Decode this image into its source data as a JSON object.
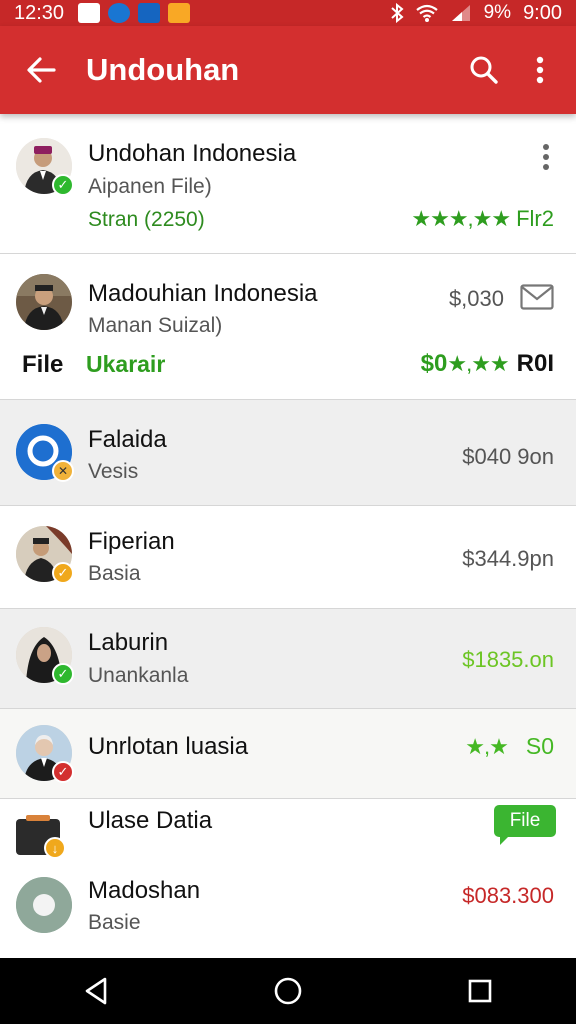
{
  "status_bar": {
    "time": "12:30",
    "battery": "9%",
    "clock": "9:00"
  },
  "app_bar": {
    "title": "Undouhan"
  },
  "items": [
    {
      "name": "Undohan Indonesia",
      "sub": "Aipanen File)",
      "extra": "Stran (2250)",
      "stars": "★★★,★★",
      "rating_text": "Flr2",
      "badge": "check-green"
    },
    {
      "name": "Madouhian Indonesia",
      "sub": "Manan Suizal)",
      "price": "$,030",
      "file_label": "File",
      "extra": "Ukarair",
      "price2_prefix": "$0",
      "stars": "★,★★",
      "rating_text": "R0I"
    },
    {
      "name": "Falaida",
      "sub": "Vesis",
      "price": "$040 9on",
      "badge": "tools-yellow"
    },
    {
      "name": "Fiperian",
      "sub": "Basia",
      "price": "$344.9pn",
      "badge": "check-yellow"
    },
    {
      "name": "Laburin",
      "sub": "Unankanla",
      "price": "$1835.on",
      "badge": "check-green"
    },
    {
      "name": "Unrlotan luasia",
      "stars": "★,★",
      "price": "S0",
      "badge": "check-red"
    },
    {
      "name": "Ulase Datia",
      "chip": "File"
    },
    {
      "name": "Madoshan",
      "sub": "Basie",
      "price": "$083.300"
    }
  ],
  "colors": {
    "app_bar": "#d32f2f",
    "accent_green": "#2e9d1f",
    "price_red": "#c62828",
    "price_green": "#6cc524"
  }
}
